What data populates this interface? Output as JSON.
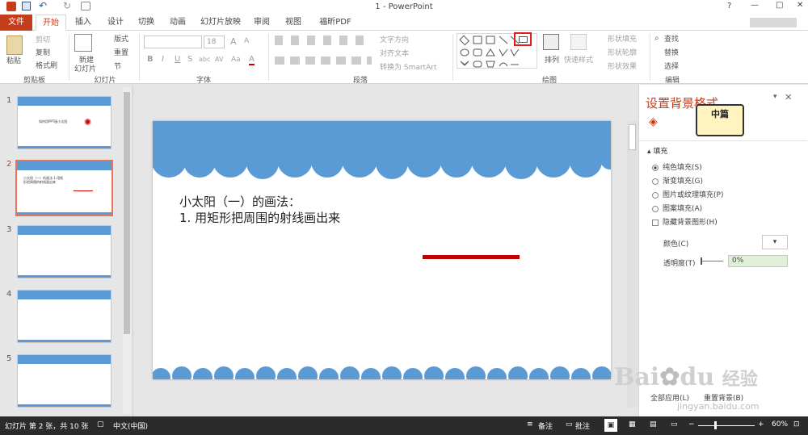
{
  "window": {
    "title": "1 - PowerPoint",
    "help": "?",
    "minimize": "—",
    "maximize": "□",
    "close": "✕"
  },
  "quick_access": {
    "save": "save-icon",
    "undo": "undo-icon",
    "redo": "redo-icon",
    "present": "present-icon"
  },
  "tabs": [
    {
      "label": "文件"
    },
    {
      "label": "开始"
    },
    {
      "label": "插入"
    },
    {
      "label": "设计"
    },
    {
      "label": "切换"
    },
    {
      "label": "动画"
    },
    {
      "label": "幻灯片放映"
    },
    {
      "label": "审阅"
    },
    {
      "label": "视图"
    },
    {
      "label": "福昕PDF"
    }
  ],
  "ribbon": {
    "clipboard": {
      "paste": "粘贴",
      "cut": "剪切",
      "copy": "复制",
      "format_painter": "格式刷",
      "group": "剪贴板"
    },
    "slides": {
      "new_slide_1": "新建",
      "new_slide_2": "幻灯片",
      "layout": "版式",
      "reset": "重置",
      "section": "节",
      "group": "幻灯片"
    },
    "font": {
      "font_size": "18",
      "group": "字体",
      "bold": "B",
      "italic": "I",
      "underline": "U",
      "strike": "S",
      "shadow": "abc",
      "spacing": "AV",
      "case": "Aa",
      "color": "A",
      "grow": "A",
      "shrink": "A"
    },
    "paragraph": {
      "text_direction": "文字方向",
      "align_text": "对齐文本",
      "smartart": "转换为 SmartArt",
      "group": "段落"
    },
    "drawing": {
      "arrange": "排列",
      "quick_styles": "快速样式",
      "shape_fill": "形状填充",
      "shape_outline": "形状轮廓",
      "shape_effects": "形状效果",
      "group": "绘图"
    },
    "editing": {
      "find": "查找",
      "replace": "替换",
      "select": "选择",
      "group": "编辑"
    }
  },
  "thumbnails": [
    {
      "num": "1",
      "text": "如何用PPT画小太阳"
    },
    {
      "num": "2",
      "text": "小太阳（一）的画法 1.用矩形把周围的射线画出来"
    },
    {
      "num": "3",
      "text": ""
    },
    {
      "num": "4",
      "text": ""
    },
    {
      "num": "5",
      "text": ""
    }
  ],
  "slide": {
    "line1": "小太阳（一）的画法：",
    "line2": "1. 用矩形把周围的射线画出来",
    "theme_color": "#5b9bd5",
    "bar_color": "#c00000"
  },
  "pane": {
    "title": "设置背景格式",
    "section": "填充",
    "options": [
      "纯色填充(S)",
      "渐变填充(G)",
      "图片或纹理填充(P)",
      "图案填充(A)"
    ],
    "hide_graphics": "隐藏背景图形(H)",
    "color_label": "颜色(C)",
    "transparency_label": "透明度(T)",
    "transparency_value": "0%",
    "apply_all": "全部应用(L)",
    "reset_bg": "重置背景(B)",
    "sticker": "中篇"
  },
  "status": {
    "slide_info": "幻灯片 第 2 张，共 10 张",
    "language": "中文(中国)",
    "notes": "备注",
    "comments": "批注",
    "zoom": "60%"
  },
  "watermark": {
    "brand": "Bai",
    "brand2": "du",
    "jy": "经验",
    "url": "jingyan.baidu.com"
  }
}
